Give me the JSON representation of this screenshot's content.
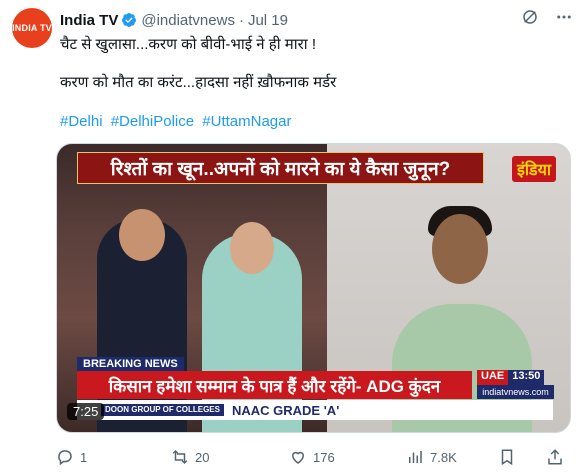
{
  "account": {
    "avatar_text": "INDIA TV",
    "name": "India TV",
    "handle": "@indiatvnews",
    "separator": "·",
    "date": "Jul 19"
  },
  "tweet": {
    "line1": "चैट से खुलासा...करण को बीवी-भाई ने ही मारा !",
    "line2": "करण को मौत का करंट...हादसा नहीं ख़ौफनाक मर्डर",
    "hashtags": [
      "#Delhi",
      "#DelhiPolice",
      "#UttamNagar"
    ]
  },
  "video": {
    "headline": "रिश्तों का खून..अपनों को मारने का ये कैसा जुनून?",
    "channel_logo": "इंडिया",
    "breaking_label": "BREAKING NEWS",
    "ticker": "किसान हमेशा सम्मान के पात्र हैं और रहेंगे- ADG कुंदन",
    "location": "UAE",
    "clock": "13:50",
    "website": "indiatvnews.com",
    "sponsor": "DOON GROUP OF COLLEGES",
    "sponsor_tag": "NAAC GRADE 'A'",
    "duration": "7:25"
  },
  "actions": {
    "replies": "1",
    "reposts": "20",
    "likes": "176",
    "views": "7.8K"
  },
  "colors": {
    "link": "#1d9bf0",
    "verified": "#1d9bf0",
    "muted": "#536471"
  }
}
